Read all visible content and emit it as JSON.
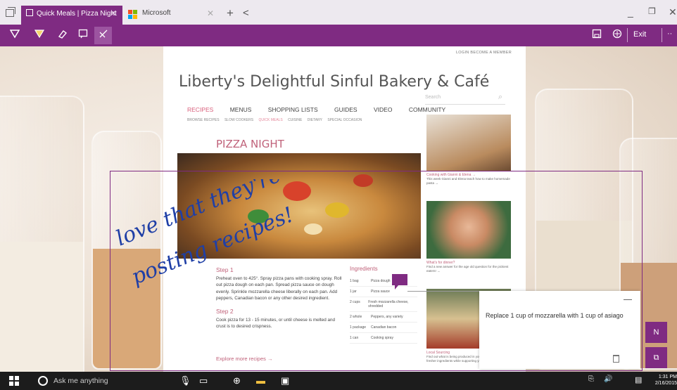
{
  "browser": {
    "tabs": [
      {
        "title": "Quick Meals | Pizza Night",
        "active": true
      },
      {
        "title": "Microsoft",
        "active": false
      }
    ],
    "new_tab_symbol": "+",
    "tabs_back_symbol": "<",
    "window_controls": {
      "minimize": "_",
      "restore": "❐",
      "close": "✕"
    }
  },
  "ink_toolbar": {
    "exit_label": "Exit",
    "more_symbol": "··"
  },
  "page": {
    "top_links": "LOGIN   BECOME A MEMBER",
    "site_title": "Liberty's Delightful Sinful Bakery & Café",
    "search_placeholder": "Search",
    "nav": [
      "RECIPES",
      "MENUS",
      "SHOPPING LISTS",
      "GUIDES",
      "VIDEO",
      "COMMUNITY"
    ],
    "subnav": [
      "BROWSE RECIPES",
      "SLOW COOKERS",
      "QUICK MEALS",
      "CUISINE",
      "DIETARY",
      "SPECIAL OCCASION"
    ],
    "recipe_title": "PIZZA NIGHT",
    "step1_title": "Step 1",
    "step1_text": "Preheat oven to 425°. Spray pizza pans with cooking spray. Roll out pizza dough on each pan. Spread pizza sauce on dough evenly. Sprinkle mozzarella cheese liberally on each pan. Add peppers, Canadian bacon or any other desired ingredient.",
    "step2_title": "Step 2",
    "step2_text": "Cook pizza for 13 - 15 minutes, or until cheese is melted and crust is to desired crispness.",
    "more_link": "Explore more recipes →",
    "ingredients_title": "Ingredients",
    "ingredients": [
      {
        "qty": "1 bag",
        "item": "Pizza dough"
      },
      {
        "qty": "1 jar",
        "item": "Pizza sauce"
      },
      {
        "qty": "2 cups",
        "item": "Fresh mozzarella cheese, shredded"
      },
      {
        "qty": "2 whole",
        "item": "Peppers, any variety"
      },
      {
        "qty": "1 package",
        "item": "Canadian bacon"
      },
      {
        "qty": "1 can",
        "item": "Cooking spray"
      }
    ],
    "sidebar": [
      {
        "title": "Cooking with Gianni & Elena →",
        "desc": "This week Gianni and Elena teach how to make homemade pasta →"
      },
      {
        "title": "What's for dinner?",
        "desc": "Find a new answer for the age old question for the pickiest eaters! →"
      },
      {
        "title": "Local Sourcing",
        "desc": "Find out what is being produced in your own backyard for fresher ingredients while supporting your local producers →"
      }
    ]
  },
  "annotation": {
    "handwriting_lines": [
      "love that they're",
      "posting recipes!"
    ],
    "comment_text": "Replace 1 cup of mozzarella with 1 cup of asiago"
  },
  "taskbar": {
    "search_placeholder": "Ask me anything",
    "time": "1:31 PM",
    "date": "2/16/2015"
  },
  "colors": {
    "accent": "#7f2b82",
    "site_accent": "#c0627a",
    "taskbar": "#1c1c1c"
  }
}
